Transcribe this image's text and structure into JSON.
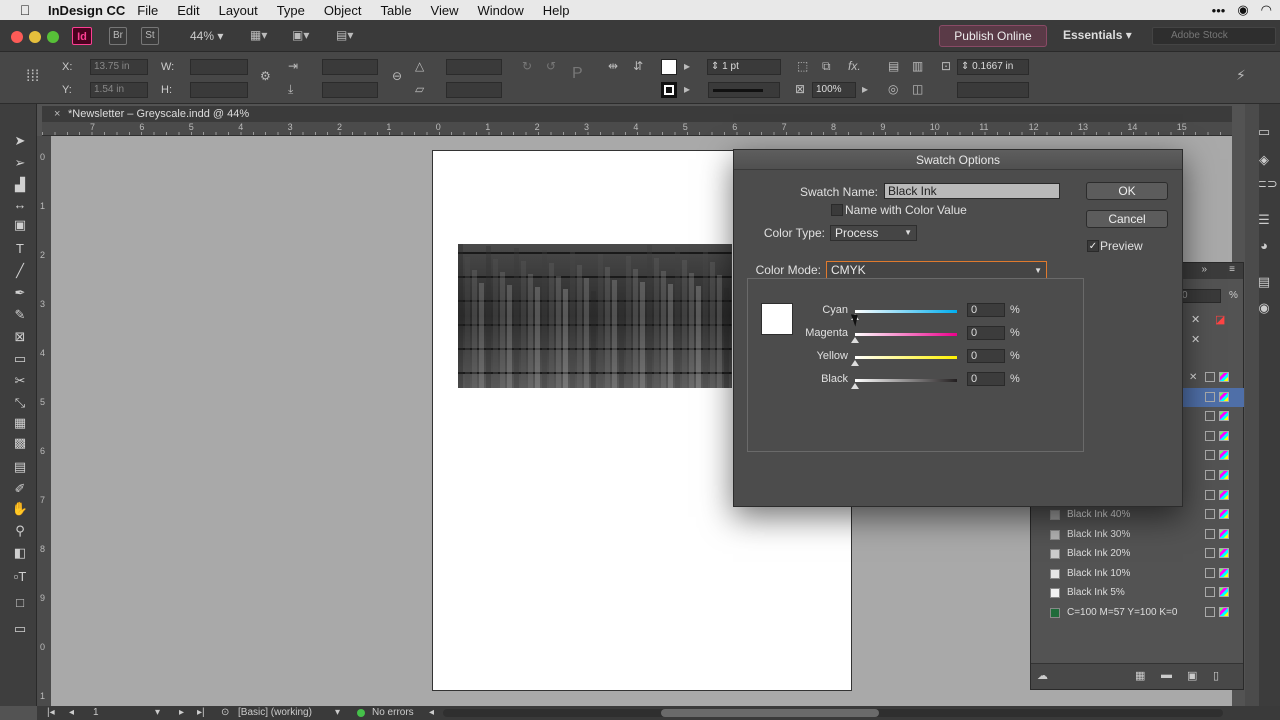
{
  "menubar": {
    "app_name": "InDesign CC",
    "items": [
      "File",
      "Edit",
      "Layout",
      "Type",
      "Object",
      "Table",
      "View",
      "Window",
      "Help"
    ]
  },
  "appbar": {
    "bridge_label": "Br",
    "stock_label": "St",
    "zoom": "44%",
    "publish_label": "Publish Online",
    "workspace": "Essentials",
    "search_placeholder": "Adobe Stock",
    "logo_text": "Id"
  },
  "control": {
    "x_label": "X:",
    "y_label": "Y:",
    "w_label": "W:",
    "h_label": "H:",
    "x_value": "13.75 in",
    "y_value": "1.54 in",
    "stroke_weight": "1 pt",
    "opacity": "100%",
    "offset": "0.1667 in"
  },
  "document": {
    "tab_title": "*Newsletter – Greyscale.indd @ 44%",
    "close_glyph": "×"
  },
  "hruler_marks": [
    "7",
    "6",
    "5",
    "4",
    "3",
    "2",
    "1",
    "0",
    "1",
    "2",
    "3",
    "4",
    "5",
    "6",
    "7",
    "8",
    "9",
    "10",
    "11",
    "12",
    "13",
    "14",
    "15"
  ],
  "vruler_marks": [
    "0",
    "1",
    "2",
    "3",
    "4",
    "5",
    "6",
    "7",
    "8",
    "9",
    "0",
    "1"
  ],
  "dialog": {
    "title": "Swatch Options",
    "swatch_name_label": "Swatch Name:",
    "swatch_name_value": "Black Ink",
    "name_with_color_label": "Name with Color Value",
    "color_type_label": "Color Type:",
    "color_type_value": "Process",
    "color_mode_label": "Color Mode:",
    "color_mode_value": "CMYK",
    "ok_label": "OK",
    "cancel_label": "Cancel",
    "preview_label": "Preview",
    "preview_checked": "✓",
    "sliders": [
      {
        "label": "Cyan",
        "value": "0",
        "unit": "%",
        "color": "#00aeef"
      },
      {
        "label": "Magenta",
        "value": "0",
        "unit": "%",
        "color": "#ec008c"
      },
      {
        "label": "Yellow",
        "value": "0",
        "unit": "%",
        "color": "#fff200"
      },
      {
        "label": "Black",
        "value": "0",
        "unit": "%",
        "color": "#231f20"
      }
    ]
  },
  "swatches_panel": {
    "header_value": "0",
    "header_unit": "%",
    "items": [
      {
        "name": "Black Ink 40%",
        "color": "#999999"
      },
      {
        "name": "Black Ink 30%",
        "color": "#b3b3b3"
      },
      {
        "name": "Black Ink 20%",
        "color": "#cccccc"
      },
      {
        "name": "Black Ink 10%",
        "color": "#e6e6e6"
      },
      {
        "name": "Black Ink 5%",
        "color": "#f2f2f2"
      },
      {
        "name": "C=100 M=57 Y=100 K=0",
        "color": "#1f6b3a"
      }
    ]
  },
  "status": {
    "page": "1",
    "preflight_profile": "[Basic] (working)",
    "errors": "No errors"
  }
}
